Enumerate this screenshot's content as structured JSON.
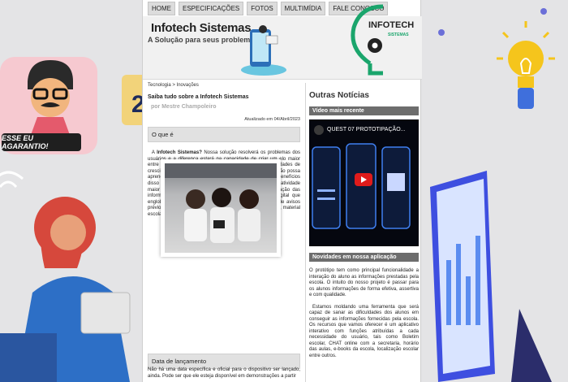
{
  "nav": [
    "HOME",
    "ESPECIFICAÇÕES",
    "FOTOS",
    "MULTIMÍDIA",
    "FALE CONOSCO"
  ],
  "header": {
    "title": "Infotech Sistemas",
    "subtitle": "A Solução para seus problemas",
    "logo_line1": "INFOTECH",
    "logo_line2": "SISTEMAS"
  },
  "background": {
    "badge": "ESSE EU AGARANTIO!",
    "calendar_number": "2"
  },
  "article": {
    "breadcrumb": "Tecnologia > Inovações",
    "title": "Saiba tudo sobre a Infotech Sistemas",
    "author": "por Mestre Champoleiro",
    "date": "Atualizado em 04/Abril/2023",
    "section1": "O que é",
    "lead": "Infotech Sistemas?",
    "body_intro": "A",
    "body": "Nossa solução resolverá os problemas dos usuários e a diferença estará na capacidade de criar um elo maior entre alunos e professores, assim desenvolvendo oportunidades de crescimento para ambos, pois ninguém é tão grande que não possa aprender, nem tão pequeno que não possa ensinar. Os benefícios disso são as informações atualizadas da escola, uma interatividade maior e a rapidez, acessibilidade e praticidade na divulgação das informações. Nossa solução trata-se de um aplicativo digital que englobaria todas as informações do ambiente escolar, desde avisos prévios sobre horários das aulas, eventos, reuniões, feriados, material escolar se estendendo até matrículas dos alunos.",
    "section2": "Data de lançamento",
    "body2": "Não há uma data específica e oficial para o dispositivo ser lançado, ainda. Pode ser que ele esteja disponível em demonstrações a partir"
  },
  "sidebar": {
    "title": "Outras Notícias",
    "video_head": "Vídeo mais recente",
    "video_title": "QUEST 07 PROTOTIPAÇÃO...",
    "news_head": "Novidades em nossa aplicação",
    "news_p1": "O protótipo tem como principal funcionalidade a interação do aluno as informações prestadas pela escola. O intuito do nosso projeto é passar para os alunos informações de forma efetiva, assertiva e com qualidade.",
    "news_p2": "Estamos moldando uma ferramenta que será capaz de sanar as dificuldades dos alunos em conseguir as informações fornecidas pela escola. Os recursos que vamos oferecer é um aplicativo interativo com funções atribuídas a cada necessidade do usuário, tais como Boletim escolar, CHAT online com a secretaria, horário das aulas, e-books da escola, localização escolar entre outros."
  },
  "colors": {
    "nav_bg": "#dcdcdc",
    "logo_green": "#1aa56c",
    "sidebar_head": "#6d6d6d",
    "play_red": "#e01b1b"
  }
}
